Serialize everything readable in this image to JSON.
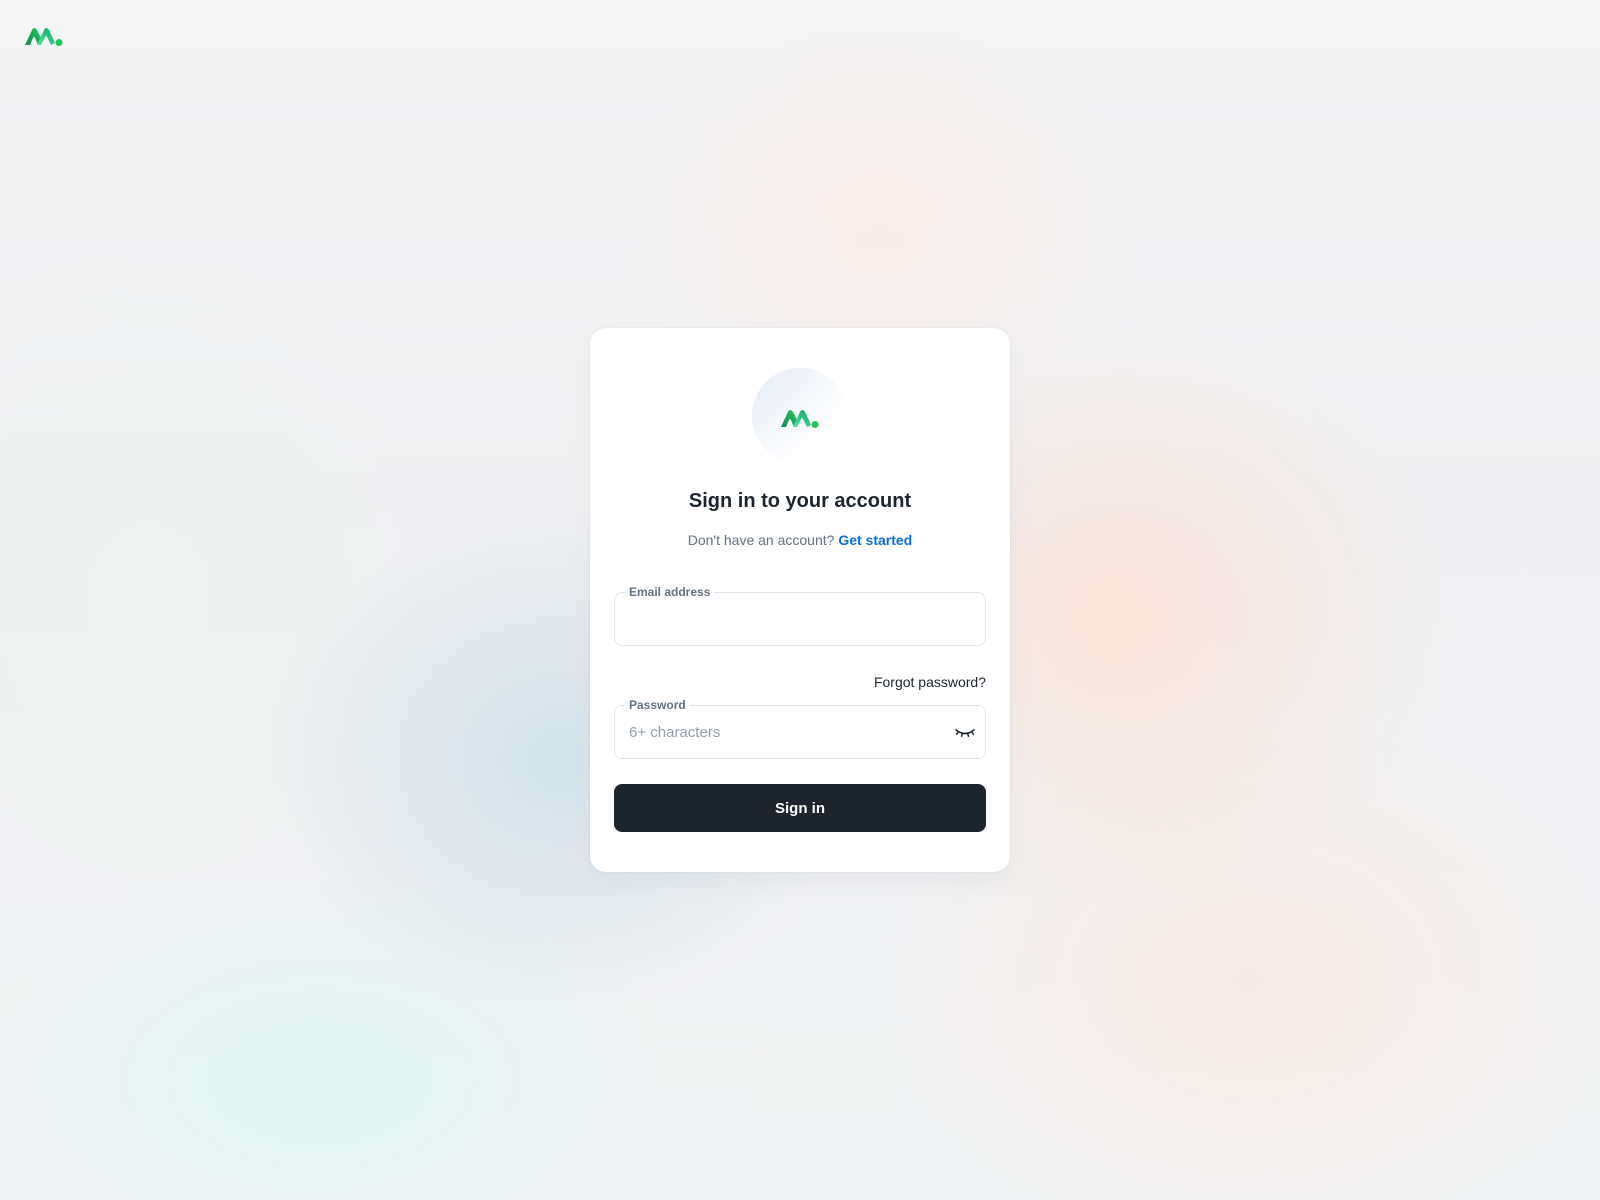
{
  "brand": {
    "logo_icon": "brand-logo-icon",
    "accent": "#22c55e"
  },
  "card": {
    "title": "Sign in to your account",
    "subtitle_prefix": "Don't have an account?",
    "get_started_label": "Get started"
  },
  "form": {
    "email": {
      "label": "Email address",
      "value": "",
      "placeholder": ""
    },
    "forgot_password_label": "Forgot password?",
    "password": {
      "label": "Password",
      "value": "",
      "placeholder": "6+ characters",
      "toggle_icon": "eye-closed-icon"
    },
    "submit_label": "Sign in"
  },
  "colors": {
    "primary_button": "#1c252e",
    "link": "#0b6ee0",
    "text_primary": "#1c252e",
    "text_secondary": "#637381"
  }
}
